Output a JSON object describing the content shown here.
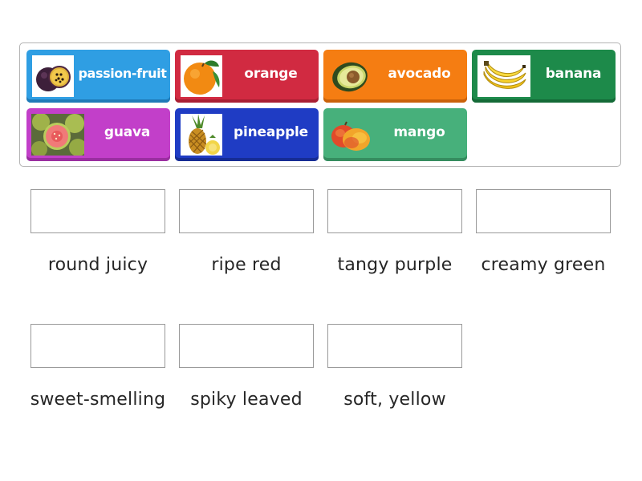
{
  "tiles": [
    {
      "label": "passion-fruit",
      "icon": "passion-fruit-icon",
      "color": "#2f9ee3"
    },
    {
      "label": "orange",
      "icon": "orange-icon",
      "color": "#d12a41"
    },
    {
      "label": "avocado",
      "icon": "avocado-icon",
      "color": "#f57d12"
    },
    {
      "label": "banana",
      "icon": "banana-icon",
      "color": "#1d8a4a"
    },
    {
      "label": "guava",
      "icon": "guava-icon",
      "color": "#c23fc9"
    },
    {
      "label": "pineapple",
      "icon": "pineapple-icon",
      "color": "#1f3cc4"
    },
    {
      "label": "mango",
      "icon": "mango-icon",
      "color": "#47b07b"
    }
  ],
  "targets": [
    {
      "caption": "round juicy"
    },
    {
      "caption": "ripe red"
    },
    {
      "caption": "tangy purple"
    },
    {
      "caption": "creamy green"
    },
    {
      "caption": "sweet-smelling"
    },
    {
      "caption": "spiky leaved"
    },
    {
      "caption": "soft, yellow"
    }
  ]
}
